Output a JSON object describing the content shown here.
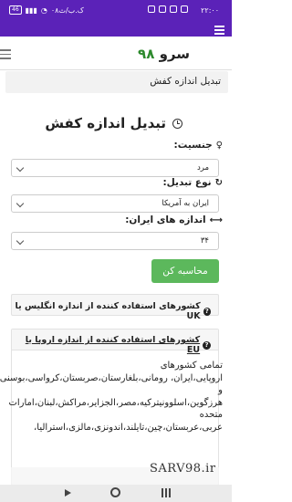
{
  "status": {
    "time": "۲۲:۰۰",
    "network": "۰۸ک.ب/ث",
    "battery": "46"
  },
  "header": {
    "logo_number": "۹۸",
    "logo_text": "سرو"
  },
  "breadcrumb": "تبدیل اندازه کفش",
  "page_title": "تبدیل اندازه کفش",
  "form": {
    "gender_label": "جنسیت:",
    "gender_value": "مرد",
    "conversion_label": "نوع تبدیل:",
    "conversion_value": "ایران به آمریکا",
    "size_label": "اندازه های ایران:",
    "size_value": "۳۴",
    "submit_label": "محاسبه کن"
  },
  "faq": {
    "uk_question": "کشورهای استفاده کننده از اندازه انگلیس یا UK",
    "eu_question": "کشورهای استفاده کننده از اندازه اروپا یا EU",
    "eu_answer_lines": [
      "تمامی کشورهای",
      "اروپایی،ایران، رومانی،بلغارستان،صربستان،کرواسی،بوسنی",
      "و",
      "هرزگوین،اسلوونیترکیه،مصر،الجزایر،مراکش،لبنان،امارات",
      "متحده",
      "عربی،عربستان،چین،تایلند،اندونزی،مالزی،استرالیا،"
    ]
  },
  "watermark": "SARV98.ir"
}
